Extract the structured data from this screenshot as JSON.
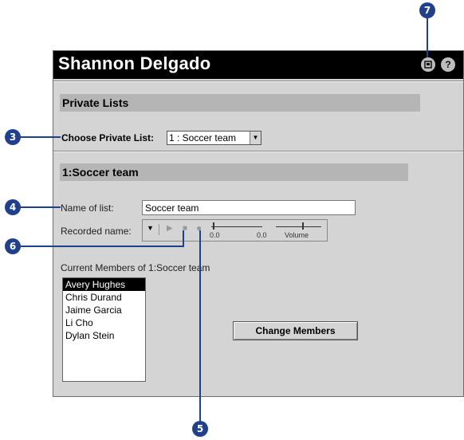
{
  "window": {
    "title": "Shannon Delgado"
  },
  "titlebar_icons": {
    "left_icon": "window-icon",
    "help_icon": "help-icon",
    "help_glyph": "?"
  },
  "private_lists": {
    "section_title": "Private Lists",
    "choose_label": "Choose Private List:",
    "selected": "1 : Soccer team"
  },
  "list_detail": {
    "section_title": "1:Soccer team",
    "name_label": "Name of list:",
    "name_value": "Soccer team",
    "recorded_label": "Recorded name:",
    "recorder": {
      "time_start": "0.0",
      "time_end": "0.0",
      "volume_label": "Volume"
    },
    "members_label": "Current Members of  1:Soccer team",
    "members": [
      "Avery Hughes",
      "Chris Durand",
      "Jaime Garcia",
      "Li Cho",
      "Dylan Stein"
    ],
    "change_members_label": "Change Members"
  },
  "callouts": {
    "c3": "3",
    "c4": "4",
    "c5": "5",
    "c6": "6",
    "c7": "7"
  },
  "colors": {
    "callout": "#1f3f8f",
    "titlebar": "#000000",
    "panel": "#d4d4d4",
    "section": "#b5b5b5"
  }
}
